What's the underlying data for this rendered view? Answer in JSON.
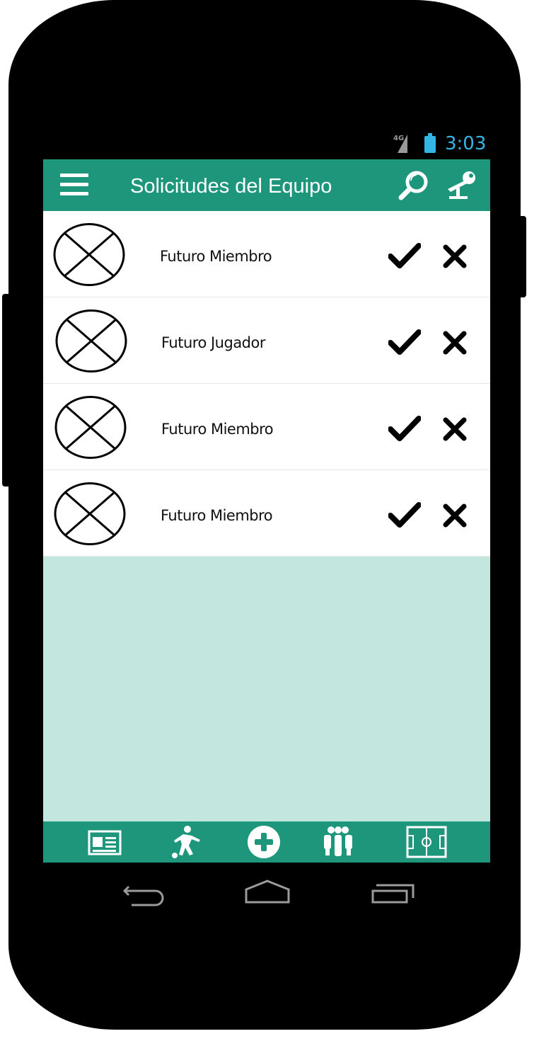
{
  "status_bar": {
    "network_label": "4G",
    "time": "3:03"
  },
  "app_bar": {
    "title": "Solicitudes del Equipo",
    "menu_icon": "hamburger-menu-icon",
    "search_icon": "magnifier-icon",
    "whistle_icon": "whistle-icon"
  },
  "requests": [
    {
      "name": "Futuro Miembro"
    },
    {
      "name": "Futuro Jugador"
    },
    {
      "name": "Futuro Miembro"
    },
    {
      "name": "Futuro Miembro"
    }
  ],
  "bottom_nav": {
    "items": [
      "news-icon",
      "player-icon",
      "add-icon",
      "team-icon",
      "field-icon"
    ]
  },
  "colors": {
    "primary": "#1e967c",
    "background": "#c3e6df",
    "status_accent": "#33b5e5"
  }
}
